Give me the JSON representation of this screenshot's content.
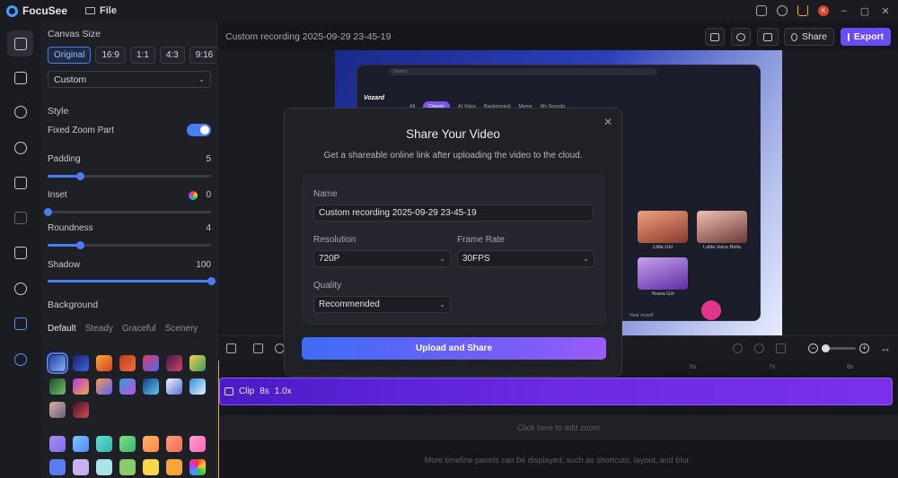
{
  "app": {
    "name": "FocuSee",
    "file_menu": "File",
    "badge_letter": "K"
  },
  "window": {
    "minimize": "–",
    "maximize": "▢",
    "close": "✕"
  },
  "editor": {
    "recording_title": "Custom recording 2025-09-29 23-45-19",
    "share_label": "Share",
    "export_label": "Export"
  },
  "panel": {
    "canvas_size_title": "Canvas Size",
    "ratios": [
      "Original",
      "16:9",
      "1:1",
      "4:3",
      "9:16"
    ],
    "selected_ratio": "Original",
    "custom_select": "Custom",
    "style_title": "Style",
    "fixed_zoom_label": "Fixed Zoom Part",
    "fixed_zoom_on": true,
    "padding_label": "Padding",
    "padding_value": "5",
    "padding_level": 0.2,
    "inset_label": "Inset",
    "inset_value": "0",
    "inset_level": 0.0,
    "roundness_label": "Roundness",
    "roundness_value": "4",
    "roundness_level": 0.2,
    "shadow_label": "Shadow",
    "shadow_value": "100",
    "shadow_level": 1.0,
    "background_title": "Background",
    "bg_tabs": [
      "Default",
      "Steady",
      "Graceful",
      "Scenery"
    ],
    "bg_tab_selected": "Default"
  },
  "preview": {
    "app_brand": "Vozard",
    "search_placeholder": "Search",
    "app_tabs": [
      "All",
      "Classic",
      "AI Voice",
      "Background",
      "Meme",
      "My Sounds"
    ],
    "voices": [
      "Little Girl",
      "Lolita Voice Bella",
      "Youna Girl"
    ],
    "hear_myself": "Hear myself"
  },
  "timeline": {
    "ruler_ticks": [
      "6s",
      "7s",
      "8s"
    ],
    "clip_label": "Clip",
    "clip_duration": "8s",
    "clip_speed": "1.0x",
    "add_zoom_hint": "Click here to add zoom",
    "footer_hint": "More timeline panels can be displayed, such as shortcuts, layout, and blur."
  },
  "dialog": {
    "title": "Share Your Video",
    "subtitle": "Get a shareable online link after uploading the video to the cloud.",
    "name_label": "Name",
    "name_value": "Custom recording 2025-09-29 23-45-19",
    "resolution_label": "Resolution",
    "resolution_value": "720P",
    "frame_rate_label": "Frame Rate",
    "frame_rate_value": "30FPS",
    "quality_label": "Quality",
    "quality_value": "Recommended",
    "upload_button": "Upload and Share"
  },
  "colors": {
    "accent": "#4c7cf4",
    "export": "#6a4cf6",
    "clip": "#6b2be0",
    "playhead": "#f2a93b"
  }
}
